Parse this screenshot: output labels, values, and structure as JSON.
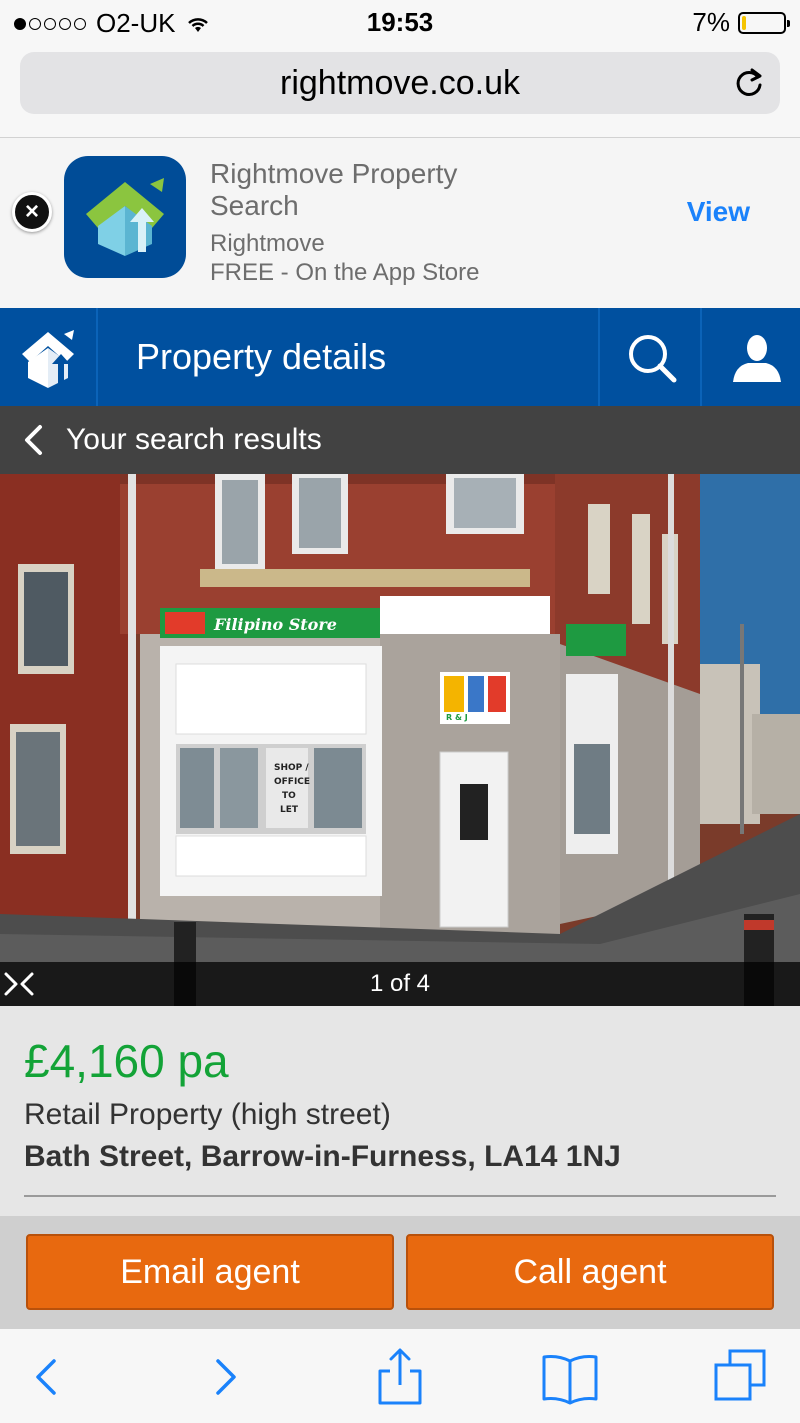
{
  "status_bar": {
    "carrier": "O2-UK",
    "time": "19:53",
    "battery": "7%"
  },
  "browser": {
    "url": "rightmove.co.uk"
  },
  "app_banner": {
    "name": "Rightmove Property Search",
    "publisher": "Rightmove",
    "price": "FREE - On the App Store",
    "view_label": "View"
  },
  "header": {
    "title": "Property details"
  },
  "back_bar": {
    "label": "Your search results"
  },
  "gallery": {
    "counter": "1 of 4",
    "sign_store": "Filipino Store",
    "sign_window": [
      "SHOP /",
      "OFFICE",
      "TO",
      "LET"
    ],
    "logo_text": "R & J"
  },
  "property": {
    "price": "£4,160 pa",
    "type": "Retail Property (high street)",
    "address": "Bath Street, Barrow-in-Furness, LA14 1NJ"
  },
  "actions": {
    "email_label": "Email agent",
    "call_label": "Call agent"
  },
  "colors": {
    "brand_blue": "#00509f",
    "price_green": "#13a337",
    "cta_orange": "#e8690f",
    "ios_blue": "#1a82fb"
  }
}
